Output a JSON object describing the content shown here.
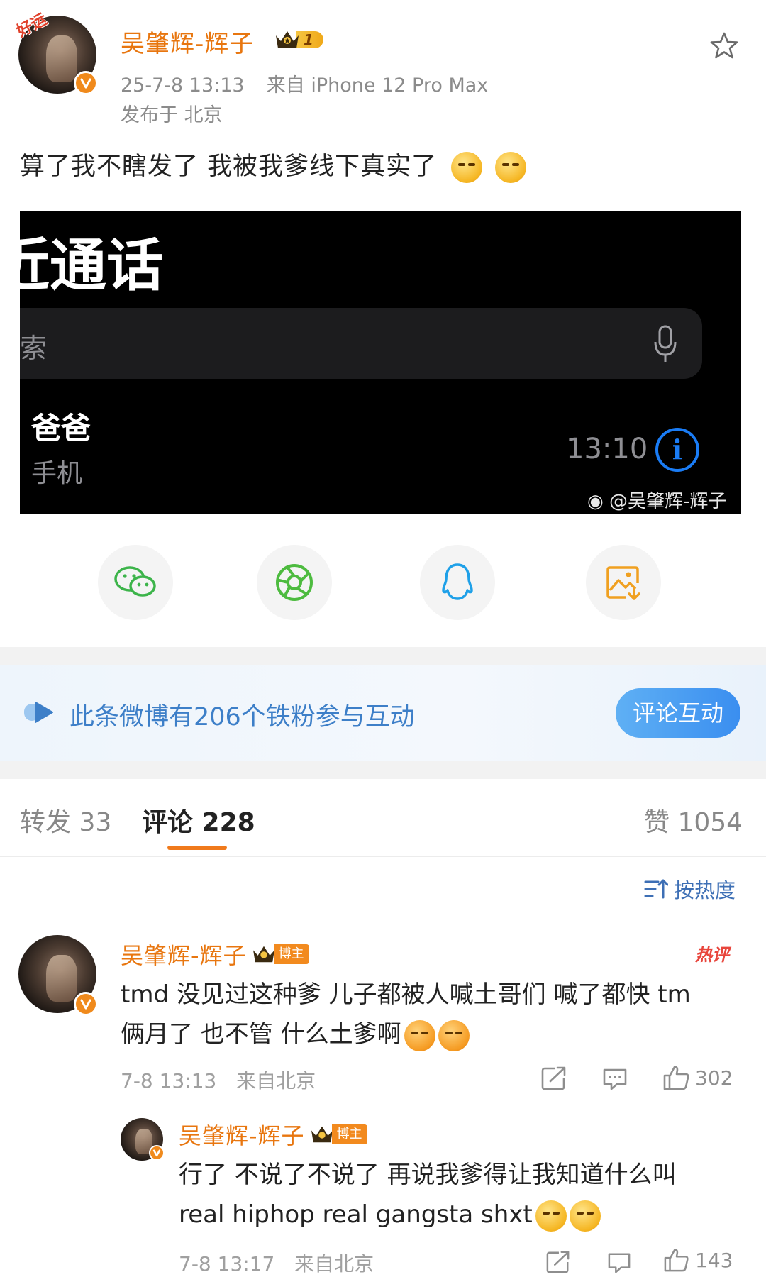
{
  "post": {
    "avatar_badge_text": "好运",
    "author": "吴肇辉-辉子",
    "level": "1",
    "timestamp": "25-7-8 13:13",
    "source": "来自 iPhone 12 Pro Max",
    "location": "发布于 北京",
    "text": "算了我不瞎发了 我被我爹线下真实了",
    "emojis": [
      "doge-smug",
      "doge-smug"
    ]
  },
  "screenshot": {
    "title": "近通话",
    "search_placeholder": "索",
    "contact_name": "爸爸",
    "contact_type": "手机",
    "call_time": "13:10",
    "watermark": "@吴肇辉-辉子"
  },
  "share": {
    "items": [
      "wechat-icon",
      "moments-icon",
      "qq-icon",
      "save-image-icon"
    ]
  },
  "fan_banner": {
    "text": "此条微博有206个铁粉参与互动",
    "button": "评论互动"
  },
  "tabs": {
    "repost": "转发 33",
    "comments": "评论 228",
    "likes": "赞 1054"
  },
  "sort": {
    "label": "按热度"
  },
  "comments": [
    {
      "author": "吴肇辉-辉子",
      "badge": "博主",
      "hot_tag": "热评",
      "line1": "tmd 没见过这种爹 儿子都被人喊土哥们 喊了都快 tm",
      "line2": "俩月了 也不管 什么土爹啊",
      "time": "7-8 13:13",
      "source": "来自北京",
      "likes": "302"
    },
    {
      "author": "吴肇辉-辉子",
      "badge": "博主",
      "line1": "行了 不说了不说了 再说我爹得让我知道什么叫",
      "line2": "real hiphop real gangsta shxt",
      "time": "7-8 13:17",
      "source": "来自北京",
      "likes": "143"
    }
  ],
  "colors": {
    "username": "#e8760f",
    "link_blue": "#3d7fc8",
    "tab_underline": "#f07a1c",
    "verified": "#f08a1c"
  }
}
